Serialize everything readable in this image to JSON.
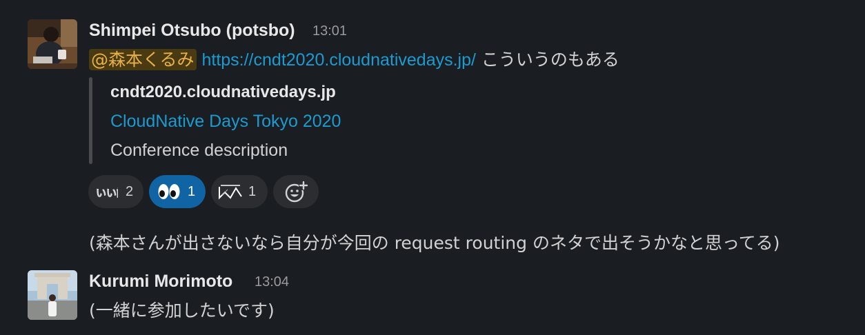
{
  "messages": [
    {
      "sender": "Shimpei Otsubo (potsbo)",
      "time": "13:01",
      "mention": "@森本くるみ",
      "link": "https://cndt2020.cloudnativedays.jp/",
      "text_after_link": " こういうのもある",
      "unfurl": {
        "site": "cndt2020.cloudnativedays.jp",
        "title": "CloudNative Days Tokyo 2020",
        "description": "Conference description"
      },
      "reactions": [
        {
          "emoji": "iine-custom-emoji",
          "count": "2",
          "active": false
        },
        {
          "emoji": "eyes-emoji",
          "count": "1",
          "active": true
        },
        {
          "emoji": "custom-emoji",
          "count": "1",
          "active": false
        }
      ],
      "followup": "(森本さんが出さないなら自分が今回の request routing のネタで出そうかなと思ってる)"
    },
    {
      "sender": "Kurumi Morimoto",
      "time": "13:04",
      "text": "(一緒に参加したいです)"
    }
  ],
  "icons": {
    "add_reaction": "add-reaction-icon"
  },
  "colors": {
    "background": "#1a1d21",
    "link": "#1d9bd1",
    "mention_bg": "#4a3a12",
    "mention_fg": "#e8b04b",
    "active_reaction": "#1164a3"
  }
}
